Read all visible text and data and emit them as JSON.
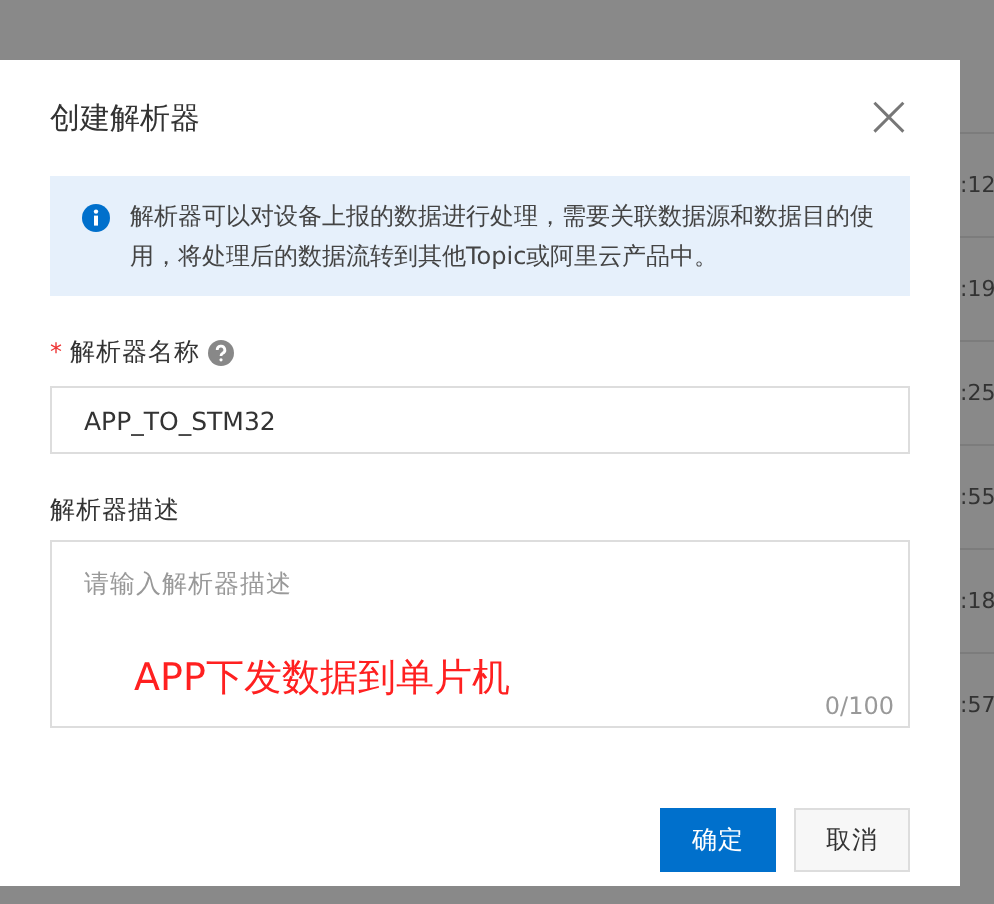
{
  "dialog": {
    "title": "创建解析器",
    "close": "×",
    "info": "解析器可以对设备上报的数据进行处理，需要关联数据源和数据目的使用，将处理后的数据流转到其他Topic或阿里云产品中。",
    "fields": [
      {
        "kind": "input",
        "required_mark": "*",
        "label": "解析器名称",
        "help": true,
        "value": "APP_TO_STM32"
      },
      {
        "kind": "textarea",
        "label": "解析器描述",
        "help": false,
        "placeholder": "请输入解析器描述",
        "counter": "0/100"
      }
    ],
    "annotation": "APP下发数据到单片机",
    "buttons": [
      {
        "label": "确定",
        "primary": true
      },
      {
        "label": "取消",
        "primary": false
      }
    ]
  },
  "background_table": {
    "times": [
      ":12",
      ":19",
      ":25",
      ":55",
      ":18",
      ":57"
    ]
  }
}
